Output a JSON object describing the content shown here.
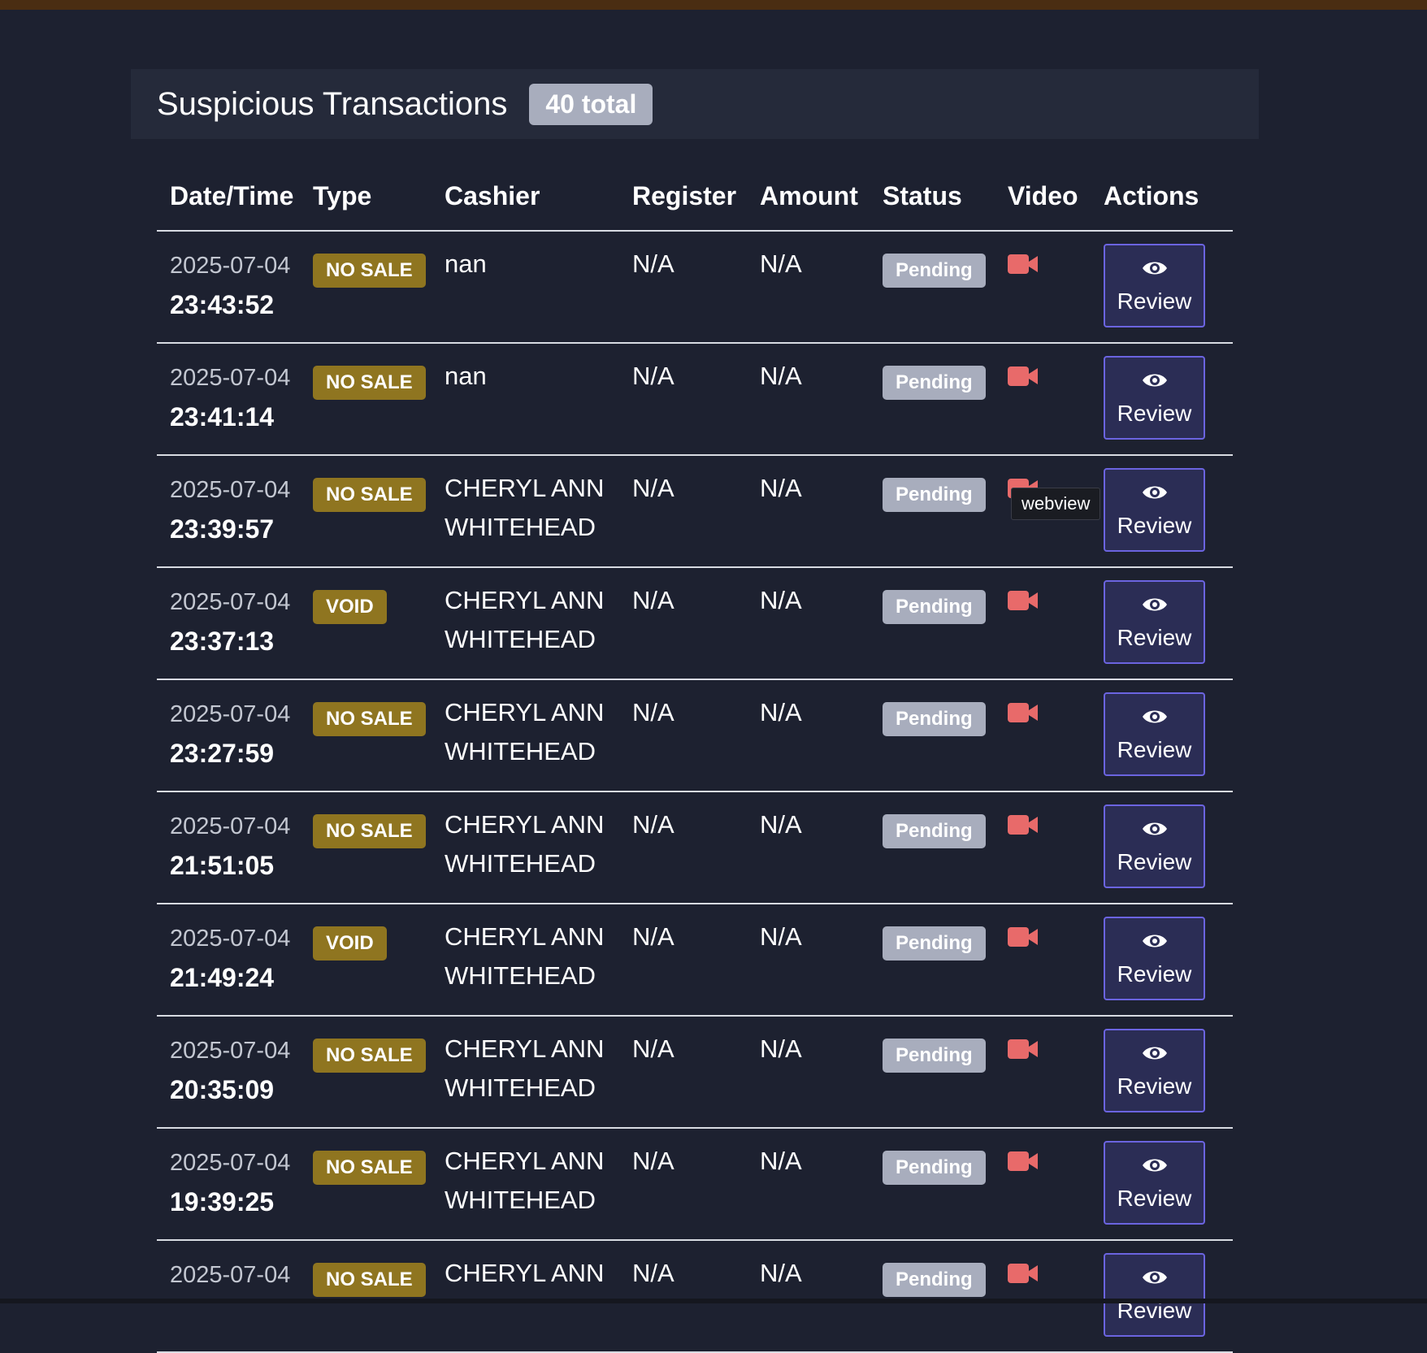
{
  "panel": {
    "title": "Suspicious Transactions",
    "total_badge": "40 total"
  },
  "columns": [
    "Date/Time",
    "Type",
    "Cashier",
    "Register",
    "Amount",
    "Status",
    "Video",
    "Actions"
  ],
  "review_label": "Review",
  "tooltip": "webview",
  "colors": {
    "video_icon": "#e86a6a",
    "type_badge": "#8f7520",
    "status_badge": "#a8adbd",
    "review_border": "#6b64e0"
  },
  "rows": [
    {
      "date": "2025-07-04",
      "time": "23:43:52",
      "type": "NO SALE",
      "cashier": [
        "nan"
      ],
      "register": "N/A",
      "amount": "N/A",
      "status": "Pending"
    },
    {
      "date": "2025-07-04",
      "time": "23:41:14",
      "type": "NO SALE",
      "cashier": [
        "nan"
      ],
      "register": "N/A",
      "amount": "N/A",
      "status": "Pending"
    },
    {
      "date": "2025-07-04",
      "time": "23:39:57",
      "type": "NO SALE",
      "cashier": [
        "CHERYL ANN",
        "WHITEHEAD"
      ],
      "register": "N/A",
      "amount": "N/A",
      "status": "Pending"
    },
    {
      "date": "2025-07-04",
      "time": "23:37:13",
      "type": "VOID",
      "cashier": [
        "CHERYL ANN",
        "WHITEHEAD"
      ],
      "register": "N/A",
      "amount": "N/A",
      "status": "Pending"
    },
    {
      "date": "2025-07-04",
      "time": "23:27:59",
      "type": "NO SALE",
      "cashier": [
        "CHERYL ANN",
        "WHITEHEAD"
      ],
      "register": "N/A",
      "amount": "N/A",
      "status": "Pending"
    },
    {
      "date": "2025-07-04",
      "time": "21:51:05",
      "type": "NO SALE",
      "cashier": [
        "CHERYL ANN",
        "WHITEHEAD"
      ],
      "register": "N/A",
      "amount": "N/A",
      "status": "Pending"
    },
    {
      "date": "2025-07-04",
      "time": "21:49:24",
      "type": "VOID",
      "cashier": [
        "CHERYL ANN",
        "WHITEHEAD"
      ],
      "register": "N/A",
      "amount": "N/A",
      "status": "Pending"
    },
    {
      "date": "2025-07-04",
      "time": "20:35:09",
      "type": "NO SALE",
      "cashier": [
        "CHERYL ANN",
        "WHITEHEAD"
      ],
      "register": "N/A",
      "amount": "N/A",
      "status": "Pending"
    },
    {
      "date": "2025-07-04",
      "time": "19:39:25",
      "type": "NO SALE",
      "cashier": [
        "CHERYL ANN",
        "WHITEHEAD"
      ],
      "register": "N/A",
      "amount": "N/A",
      "status": "Pending"
    },
    {
      "date": "2025-07-04",
      "time": "",
      "type": "NO SALE",
      "cashier": [
        "CHERYL ANN"
      ],
      "register": "N/A",
      "amount": "N/A",
      "status": "Pending"
    }
  ]
}
